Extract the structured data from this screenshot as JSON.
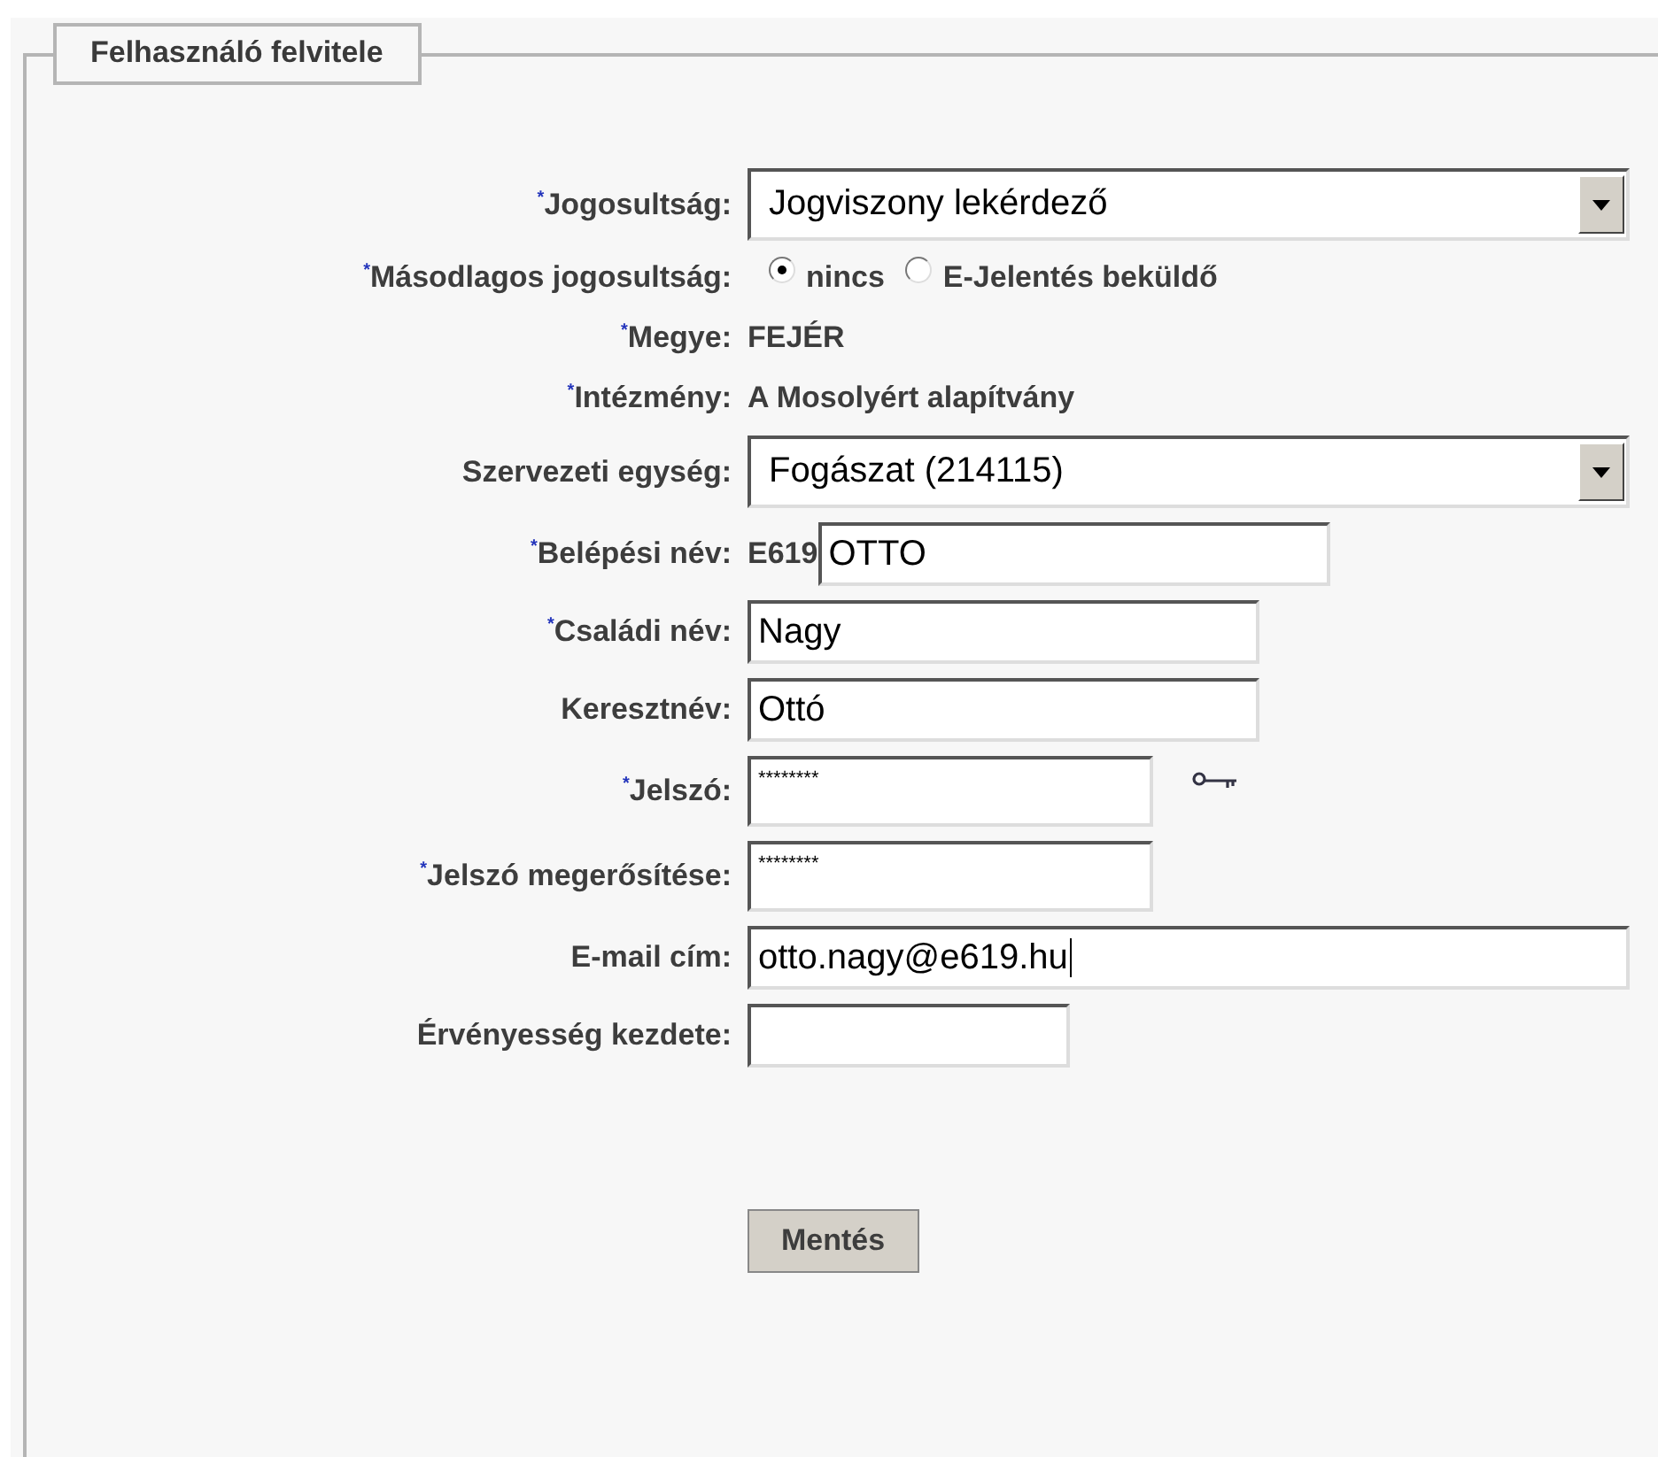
{
  "form": {
    "legend": "Felhasználó felvitele",
    "fields": [
      {
        "kind": "select",
        "label": "$^{*}$Jogosultság:",
        "value": "Jogviszony lekérdező"
      },
      {
        "kind": "radio",
        "label": "$^{*}$Másodlagos jogosultság:",
        "options": [
          {
            "label": "nincs",
            "selected": true
          },
          {
            "label": "E-Jelentés beküldő",
            "selected": false
          }
        ]
      },
      {
        "kind": "text",
        "label": "$^{*}$Megye:",
        "value": "FEJÉR"
      },
      {
        "kind": "text",
        "label": "$^{*}$Intézmény:",
        "value": "A Mosolyért alapítvány"
      },
      {
        "kind": "select",
        "label": "Szervezeti egység:",
        "value": "Fogászat (214115)"
      },
      {
        "kind": "input",
        "label": "$^{*}$Belépési név:",
        "prefix": "E619",
        "value": "OTTO"
      },
      {
        "kind": "input",
        "label": "$^{*}$Családi név:",
        "value": "Nagy"
      },
      {
        "kind": "input",
        "label": "Keresztnév:",
        "value": "Ottó"
      },
      {
        "kind": "password",
        "label": "$^{*}$Jelszó:",
        "value": "********",
        "key_icon": true
      },
      {
        "kind": "password",
        "label": "$^{*}$Jelszó megerősítése:",
        "value": "********"
      },
      {
        "kind": "email",
        "label": "E-mail cím:",
        "value": "otto.nagy@e619.hu",
        "focused": true
      },
      {
        "kind": "date",
        "label": "Érvényesség kezdete:"
      }
    ],
    "submit": "Mentés"
  }
}
